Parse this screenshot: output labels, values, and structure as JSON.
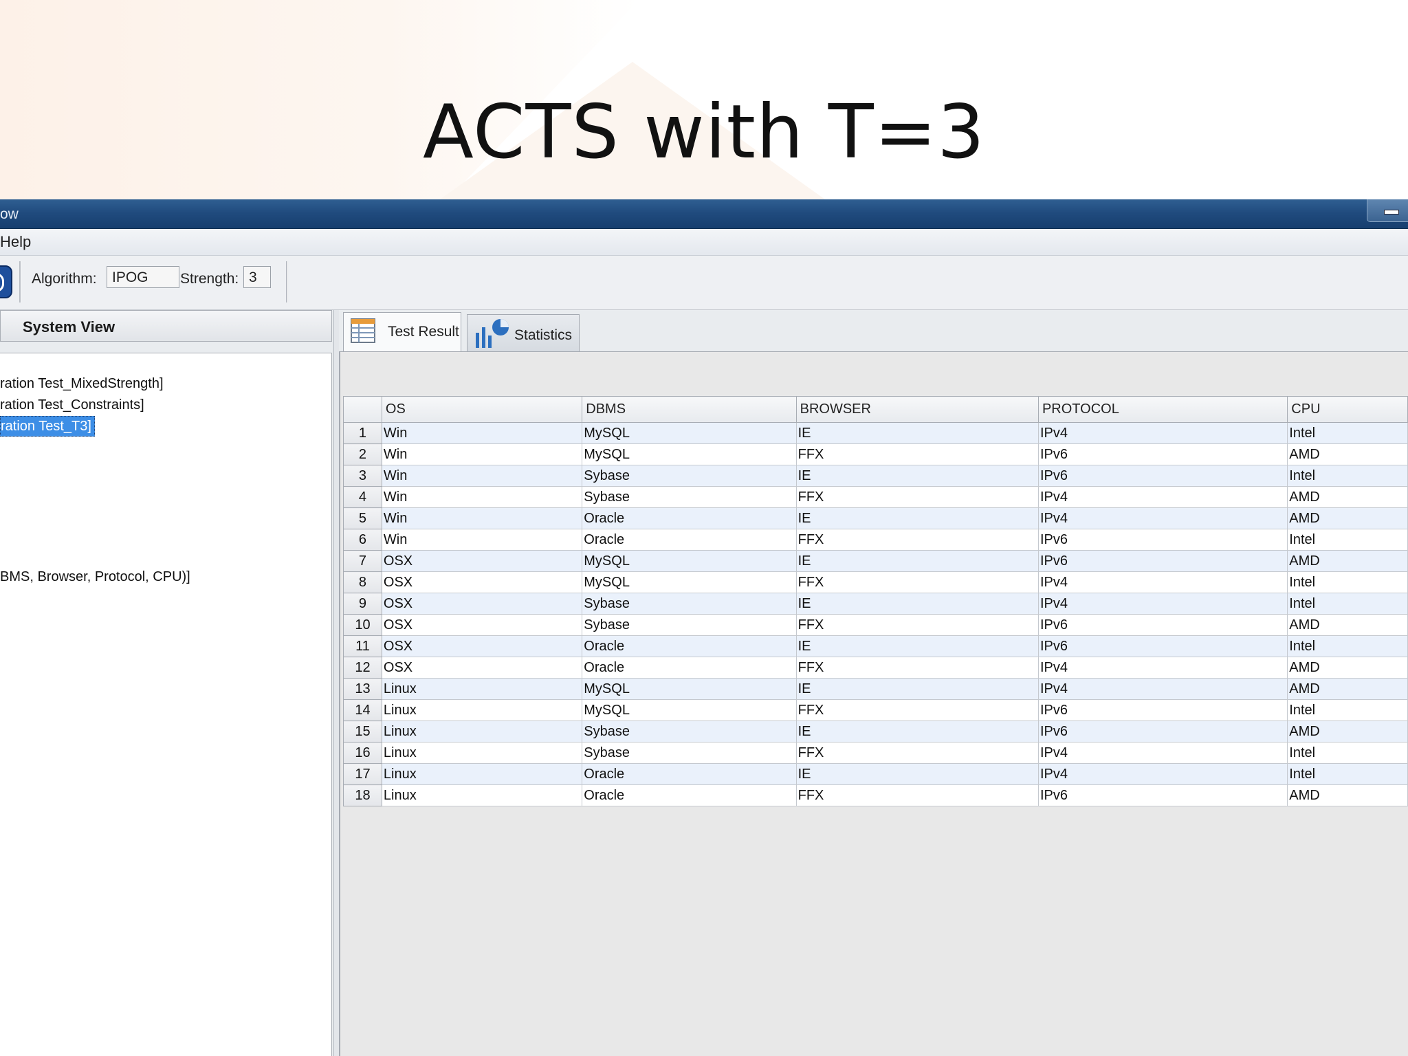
{
  "slide": {
    "title": "ACTS with T=3"
  },
  "window": {
    "title_fragment": "ow"
  },
  "menu": {
    "help": "Help"
  },
  "toolbar": {
    "algorithm_label": "Algorithm:",
    "algorithm_value": "IPOG",
    "strength_label": "Strength:",
    "strength_value": "3"
  },
  "system_view": {
    "title": "System View",
    "items": [
      "ration Test_MixedStrength]",
      "ration Test_Constraints]",
      "ration Test_T3]",
      "BMS, Browser, Protocol, CPU)]"
    ],
    "selected_index": 2
  },
  "tabs": [
    {
      "label": "Test Result",
      "icon": "table-icon",
      "active": true
    },
    {
      "label": "Statistics",
      "icon": "chart-icon",
      "active": false
    }
  ],
  "table": {
    "columns": [
      "",
      "OS",
      "DBMS",
      "BROWSER",
      "PROTOCOL",
      "CPU"
    ],
    "rows": [
      [
        "1",
        "Win",
        "MySQL",
        "IE",
        "IPv4",
        "Intel"
      ],
      [
        "2",
        "Win",
        "MySQL",
        "FFX",
        "IPv6",
        "AMD"
      ],
      [
        "3",
        "Win",
        "Sybase",
        "IE",
        "IPv6",
        "Intel"
      ],
      [
        "4",
        "Win",
        "Sybase",
        "FFX",
        "IPv4",
        "AMD"
      ],
      [
        "5",
        "Win",
        "Oracle",
        "IE",
        "IPv4",
        "AMD"
      ],
      [
        "6",
        "Win",
        "Oracle",
        "FFX",
        "IPv6",
        "Intel"
      ],
      [
        "7",
        "OSX",
        "MySQL",
        "IE",
        "IPv6",
        "AMD"
      ],
      [
        "8",
        "OSX",
        "MySQL",
        "FFX",
        "IPv4",
        "Intel"
      ],
      [
        "9",
        "OSX",
        "Sybase",
        "IE",
        "IPv4",
        "Intel"
      ],
      [
        "10",
        "OSX",
        "Sybase",
        "FFX",
        "IPv6",
        "AMD"
      ],
      [
        "11",
        "OSX",
        "Oracle",
        "IE",
        "IPv6",
        "Intel"
      ],
      [
        "12",
        "OSX",
        "Oracle",
        "FFX",
        "IPv4",
        "AMD"
      ],
      [
        "13",
        "Linux",
        "MySQL",
        "IE",
        "IPv4",
        "AMD"
      ],
      [
        "14",
        "Linux",
        "MySQL",
        "FFX",
        "IPv6",
        "Intel"
      ],
      [
        "15",
        "Linux",
        "Sybase",
        "IE",
        "IPv6",
        "AMD"
      ],
      [
        "16",
        "Linux",
        "Sybase",
        "FFX",
        "IPv4",
        "Intel"
      ],
      [
        "17",
        "Linux",
        "Oracle",
        "IE",
        "IPv4",
        "Intel"
      ],
      [
        "18",
        "Linux",
        "Oracle",
        "FFX",
        "IPv6",
        "AMD"
      ]
    ]
  },
  "colors": {
    "titlebar": "#1f4a7d",
    "selection": "#3d8ee6",
    "row_alt": "#eaf1fb"
  }
}
